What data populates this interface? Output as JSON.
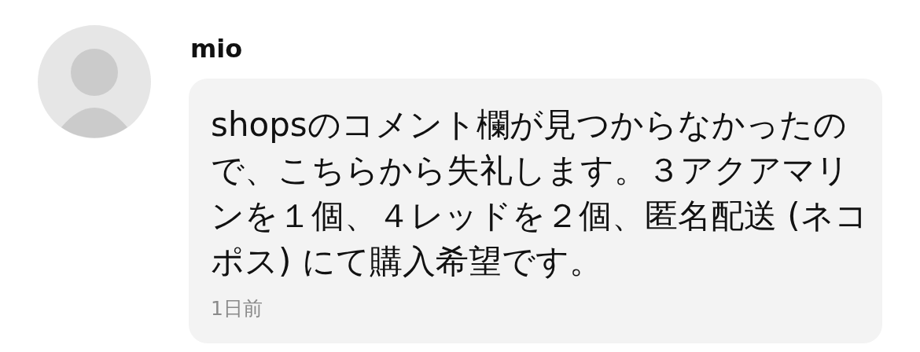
{
  "comment": {
    "author": "mio",
    "text": "shopsのコメント欄が見つからなかったので、こちらから失礼します。３アクアマリンを１個、４レッドを２個、匿名配送 (ネコポス) にて購入希望です。",
    "time": "1日前"
  }
}
